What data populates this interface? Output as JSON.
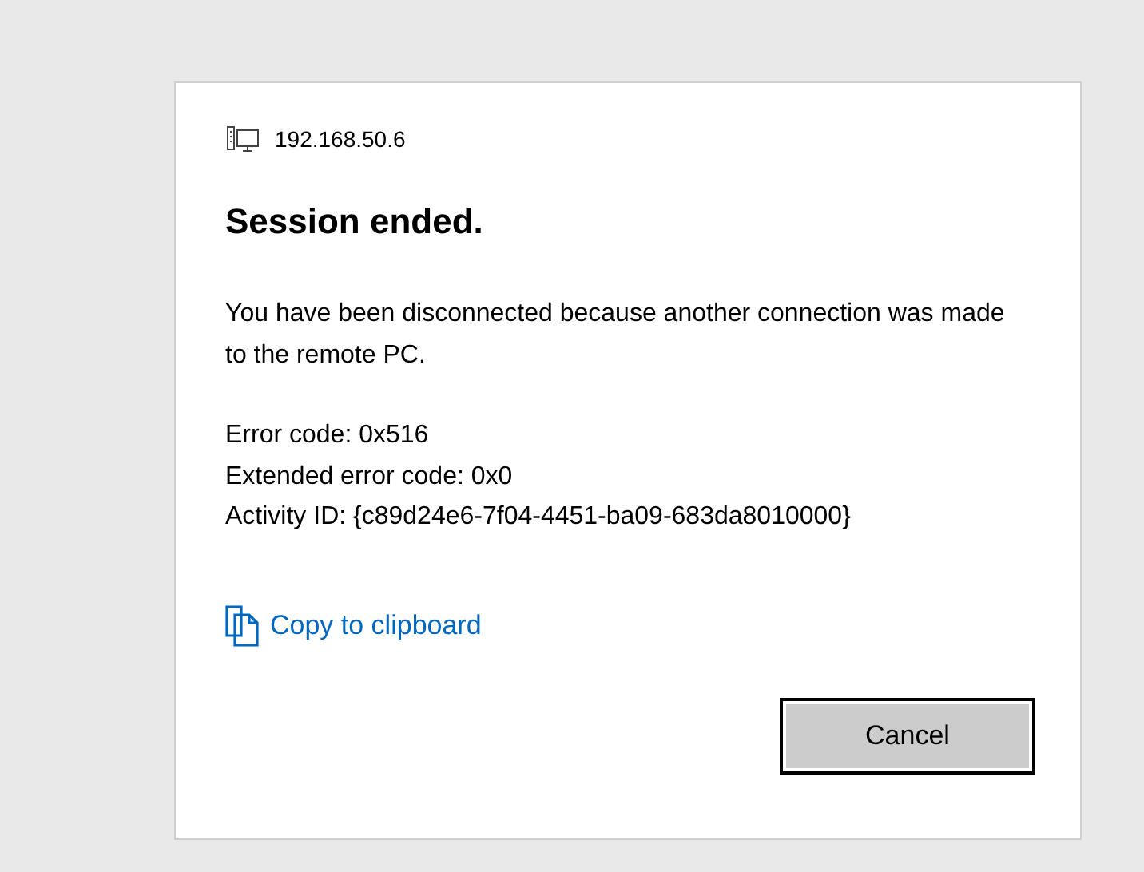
{
  "dialog": {
    "host": "192.168.50.6",
    "title": "Session ended.",
    "message": "You have been disconnected because another connection was made to the remote PC.",
    "details": [
      "Error code: 0x516",
      "Extended error code: 0x0",
      "Activity ID: {c89d24e6-7f04-4451-ba09-683da8010000}"
    ],
    "copy_link": "Copy to clipboard",
    "buttons": [
      "Cancel"
    ]
  }
}
